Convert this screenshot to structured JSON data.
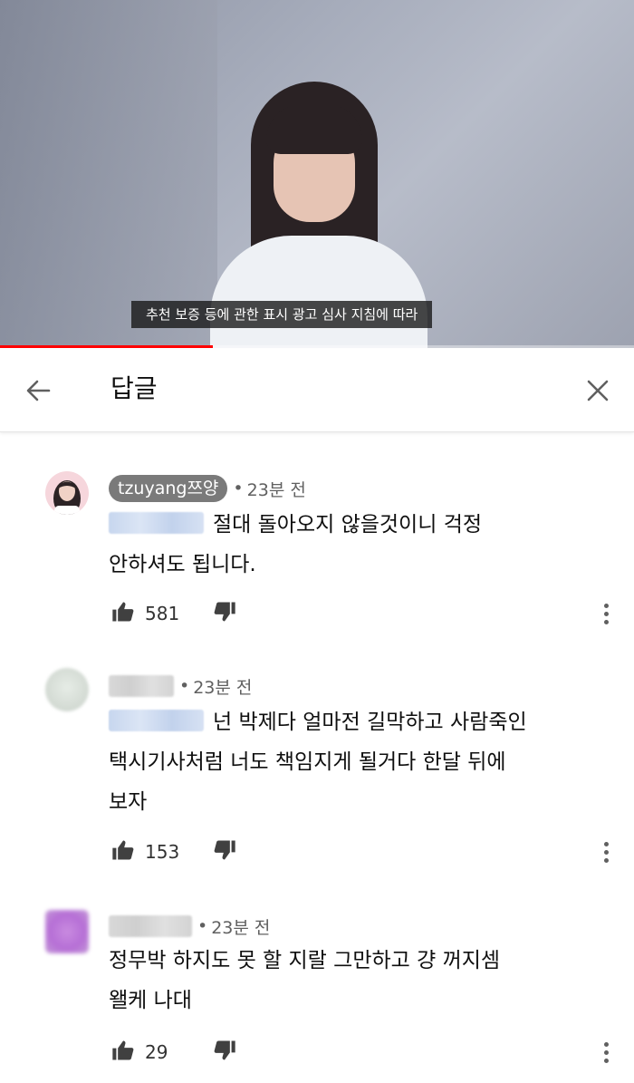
{
  "video": {
    "subtitle": "추천 보증 등에 관한 표시 광고 심사 지침에 따라",
    "progress_percent": 33.6
  },
  "header": {
    "title": "답글",
    "back_icon": "arrow-left-icon",
    "close_icon": "close-icon"
  },
  "comments": [
    {
      "author": "tzuyang쯔양",
      "author_style": "creator-chip",
      "time": "23분 전",
      "text": "절대 돌아오지 않을것이니 걱정 안하셔도 됩니다.",
      "text_line1": "절대 돌아오지 않을것이니 걱정",
      "text_line2": "안하셔도 됩니다.",
      "likes": "581"
    },
    {
      "author": "",
      "time": "23분 전",
      "text_line1": "넌 박제다 얼마전 길막하고 사람죽인",
      "text_line2": "택시기사처럼 너도 책임지게 될거다 한달 뒤에",
      "text_line3": "보자",
      "likes": "153"
    },
    {
      "author": "",
      "time": "23분 전",
      "text_line1": "정무박 하지도 못 할 지랄 그만하고 걍 꺼지셈",
      "text_line2": "왤케 나대",
      "likes": "29"
    }
  ],
  "colors": {
    "accent_red": "#ff0000",
    "creator_chip": "#7a7a7a",
    "secondary_text": "#606060"
  }
}
